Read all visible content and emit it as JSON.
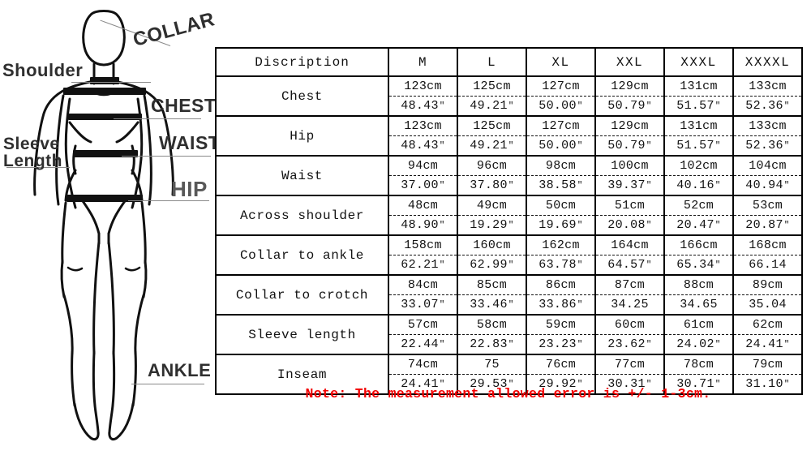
{
  "diagram": {
    "labels": {
      "collar": "COLLAR",
      "shoulder": "Shoulder",
      "chest": "CHEST",
      "waist": "WAIST",
      "hip": "HIP",
      "sleeve_line1": "Sleeve",
      "sleeve_line2": "Length",
      "ankle": "ANKLE"
    }
  },
  "table": {
    "headers": [
      "Discription",
      "M",
      "L",
      "XL",
      "XXL",
      "XXXL",
      "XXXXL"
    ],
    "rows": [
      {
        "label": "Chest",
        "cm": [
          "123cm",
          "125cm",
          "127cm",
          "129cm",
          "131cm",
          "133cm"
        ],
        "inch": [
          "48.43",
          "49.21",
          "50.00",
          "50.79",
          "51.57",
          "52.36"
        ],
        "marks": [
          true,
          true,
          true,
          true,
          true,
          true
        ]
      },
      {
        "label": "Hip",
        "cm": [
          "123cm",
          "125cm",
          "127cm",
          "129cm",
          "131cm",
          "133cm"
        ],
        "inch": [
          "48.43",
          "49.21",
          "50.00",
          "50.79",
          "51.57",
          "52.36"
        ],
        "marks": [
          true,
          true,
          true,
          true,
          true,
          true
        ]
      },
      {
        "label": "Waist",
        "cm": [
          "94cm",
          "96cm",
          "98cm",
          "100cm",
          "102cm",
          "104cm"
        ],
        "inch": [
          "37.00",
          "37.80",
          "38.58",
          "39.37",
          "40.16",
          "40.94"
        ],
        "marks": [
          true,
          true,
          true,
          true,
          true,
          true
        ]
      },
      {
        "label": "Across shoulder",
        "cm": [
          "48cm",
          "49cm",
          "50cm",
          "51cm",
          "52cm",
          "53cm"
        ],
        "inch": [
          "48.90",
          "19.29",
          "19.69",
          "20.08",
          "20.47",
          "20.87"
        ],
        "marks": [
          true,
          true,
          true,
          true,
          true,
          true
        ]
      },
      {
        "label": "Collar to ankle",
        "cm": [
          "158cm",
          "160cm",
          "162cm",
          "164cm",
          "166cm",
          "168cm"
        ],
        "inch": [
          "62.21",
          "62.99",
          "63.78",
          "64.57",
          "65.34",
          "66.14"
        ],
        "marks": [
          true,
          true,
          true,
          true,
          true,
          false
        ]
      },
      {
        "label": "Collar to crotch",
        "cm": [
          "84cm",
          "85cm",
          "86cm",
          "87cm",
          "88cm",
          "89cm"
        ],
        "inch": [
          "33.07",
          "33.46",
          "33.86",
          "34.25",
          "34.65",
          "35.04"
        ],
        "marks": [
          true,
          true,
          true,
          false,
          false,
          false
        ]
      },
      {
        "label": "Sleeve length",
        "cm": [
          "57cm",
          "58cm",
          "59cm",
          "60cm",
          "61cm",
          "62cm"
        ],
        "inch": [
          "22.44",
          "22.83",
          "23.23",
          "23.62",
          "24.02",
          "24.41"
        ],
        "marks": [
          true,
          true,
          true,
          true,
          true,
          true
        ]
      },
      {
        "label": "Inseam",
        "cm": [
          "74cm",
          "75",
          "76cm",
          "77cm",
          "78cm",
          "79cm"
        ],
        "inch": [
          "24.41",
          "29.53",
          "29.92",
          "30.31",
          "30.71",
          "31.10"
        ],
        "marks": [
          true,
          true,
          true,
          true,
          true,
          true
        ]
      }
    ],
    "inch_mark": "″"
  },
  "note": {
    "text": "Note: The measurement allowed error is +/- 1-3cm.",
    "color": "#f20000"
  }
}
